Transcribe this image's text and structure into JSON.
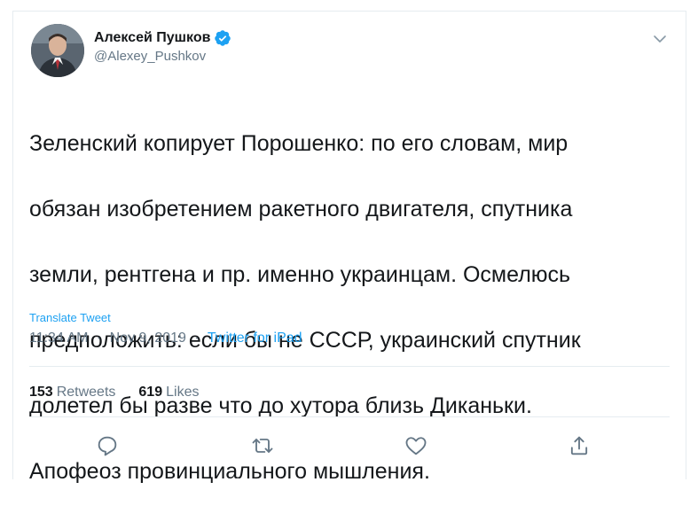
{
  "author": {
    "display_name": "Алексей Пушков",
    "handle": "@Alexey_Pushkov",
    "verified": true
  },
  "tweet": {
    "text_lines": [
      "Зеленский копирует Порошенко: по его словам, мир",
      "обязан изобретением ракетного двигателя, спутника",
      "земли, рентгена и пр. именно украинцам. Осмелюсь",
      "предположить: если бы не СССР, украинский спутник",
      "долетел бы разве что до хутора близь Диканьки.",
      "Апофеоз провинциального мышления."
    ],
    "translate_label": "Translate Tweet",
    "time": "11:34 AM",
    "date": "Nov 9, 2019",
    "source": "Twitter for iPad",
    "separator": "·"
  },
  "stats": {
    "retweets_count": "153",
    "retweets_label": "Retweets",
    "likes_count": "619",
    "likes_label": "Likes"
  },
  "icons": {
    "verified": "verified-badge-icon",
    "caret": "chevron-down-icon",
    "reply": "reply-icon",
    "retweet": "retweet-icon",
    "like": "heart-icon",
    "share": "share-icon"
  },
  "colors": {
    "accent": "#1da1f2",
    "text": "#14171a",
    "muted": "#657786",
    "border": "#e6ecf0"
  }
}
